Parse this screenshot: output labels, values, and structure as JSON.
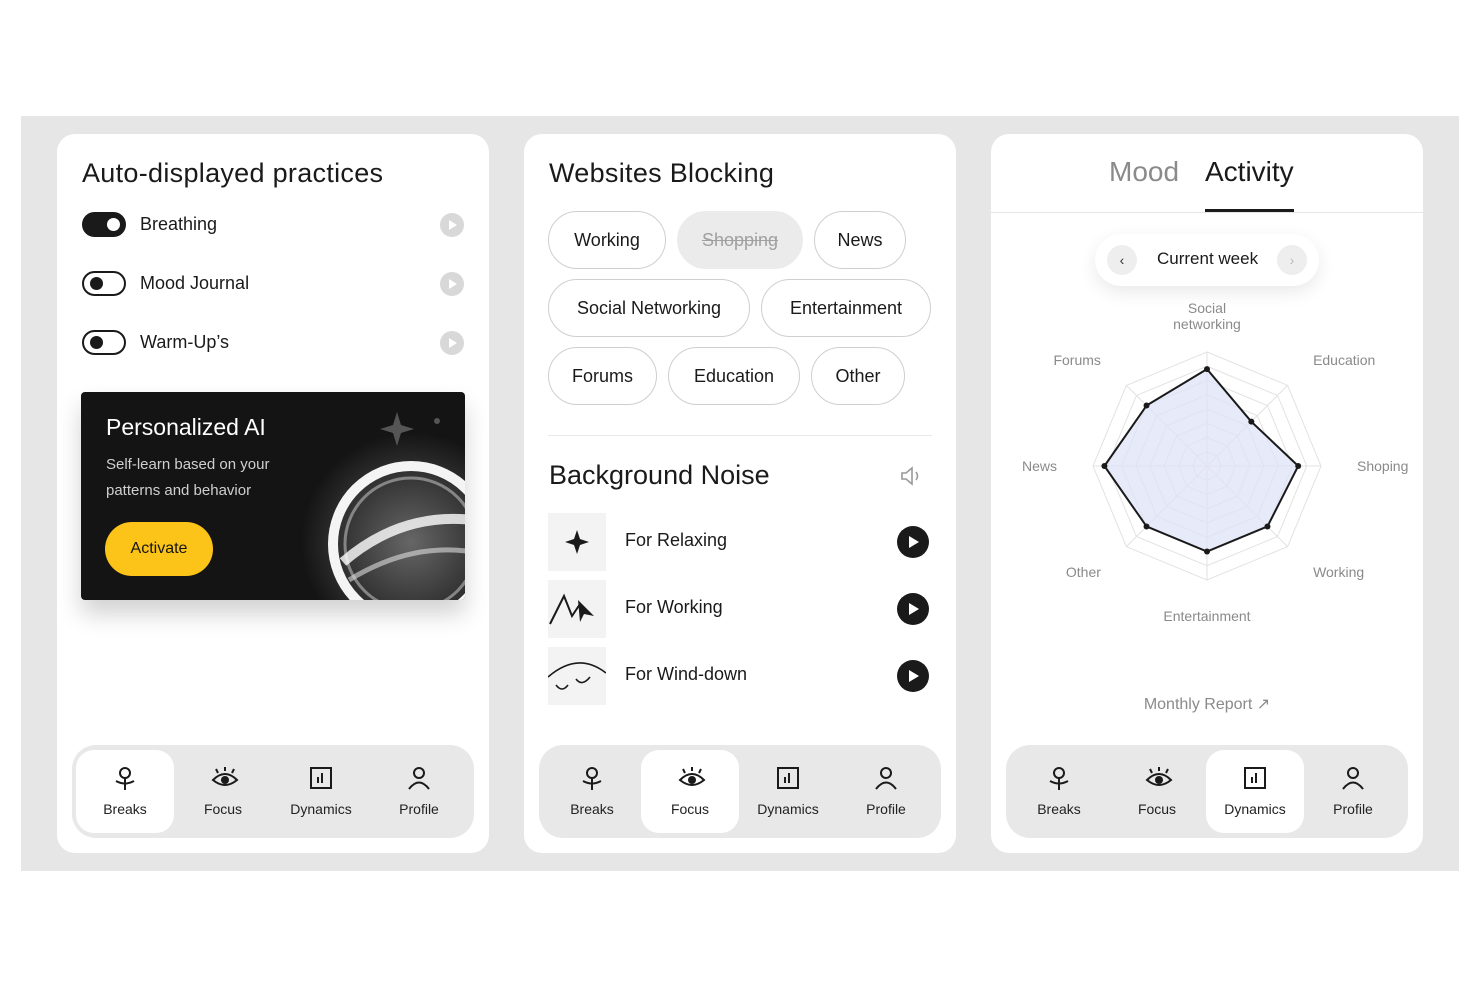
{
  "practices": {
    "title": "Auto-displayed practices",
    "items": [
      {
        "label": "Breathing",
        "enabled": true
      },
      {
        "label": "Mood Journal",
        "enabled": false
      },
      {
        "label": "Warm-Up’s",
        "enabled": false
      }
    ],
    "ai_card": {
      "title": "Personalized AI",
      "subtitle": "Self-learn based on your patterns and behavior",
      "button_label": "Activate",
      "accent": "#fcc419"
    }
  },
  "blocking": {
    "title": "Websites Blocking",
    "chips": [
      {
        "label": "Working",
        "active": true
      },
      {
        "label": "Shopping",
        "active": false
      },
      {
        "label": "News",
        "active": true
      },
      {
        "label": "Social Networking",
        "active": true
      },
      {
        "label": "Entertainment",
        "active": true
      },
      {
        "label": "Forums",
        "active": true
      },
      {
        "label": "Education",
        "active": true
      },
      {
        "label": "Other",
        "active": true
      }
    ]
  },
  "noise": {
    "title": "Background Noise",
    "items": [
      {
        "label": "For Relaxing",
        "icon": "sparkle-icon"
      },
      {
        "label": "For Working",
        "icon": "zigzag-arrow-icon"
      },
      {
        "label": "For Wind-down",
        "icon": "closed-eyes-icon"
      }
    ]
  },
  "stats": {
    "tabs": [
      "Mood",
      "Activity"
    ],
    "active_tab": "Activity",
    "period_label": "Current week",
    "report_link": "Monthly Report ↗"
  },
  "chart_data": {
    "type": "radar",
    "axes": [
      "Social networking",
      "Education",
      "Shoping",
      "Working",
      "Entertainment",
      "Other",
      "News",
      "Forums"
    ],
    "axis_labels": [
      [
        "Social",
        "networking"
      ],
      [
        "Education"
      ],
      [
        "Shoping"
      ],
      [
        "Working"
      ],
      [
        "Entertainment"
      ],
      [
        "Other"
      ],
      [
        "News"
      ],
      [
        "Forums"
      ]
    ],
    "values": [
      0.85,
      0.55,
      0.8,
      0.75,
      0.75,
      0.75,
      0.9,
      0.75
    ],
    "rings": 8,
    "range": [
      0,
      1
    ],
    "stroke_color": "#1a1a1a",
    "fill_color": "#dfe3f7"
  },
  "nav": {
    "items": [
      {
        "label": "Breaks",
        "icon": "breaks-icon"
      },
      {
        "label": "Focus",
        "icon": "eye-icon"
      },
      {
        "label": "Dynamics",
        "icon": "chart-icon"
      },
      {
        "label": "Profile",
        "icon": "profile-icon"
      }
    ]
  }
}
